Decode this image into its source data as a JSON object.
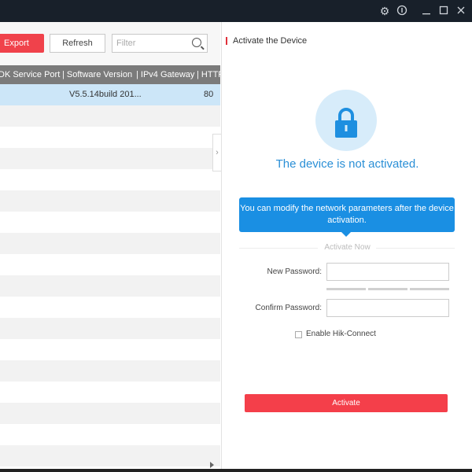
{
  "titlebar": {
    "icons": [
      "gear-icon",
      "info-icon",
      "minimize-icon",
      "maximize-icon",
      "close-icon"
    ]
  },
  "toolbar": {
    "export_label": "Export",
    "refresh_label": "Refresh",
    "filter_placeholder": "Filter"
  },
  "table": {
    "columns": [
      "DK Service Port",
      "| Software Version",
      "| IPv4 Gateway",
      "| HTTP"
    ],
    "rows": [
      {
        "software_version": "V5.5.14build 201...",
        "http": "80",
        "selected": true
      }
    ]
  },
  "panel": {
    "title": "Activate the Device",
    "status": "The device is not activated.",
    "tip": "You can modify the network parameters after the device activation.",
    "section": "Activate Now",
    "new_password_label": "New Password:",
    "confirm_password_label": "Confirm Password:",
    "new_password_value": "",
    "confirm_password_value": "",
    "hik_connect_label": "Enable Hik-Connect",
    "hik_connect_checked": false,
    "activate_label": "Activate"
  },
  "colors": {
    "accent_red": "#f43f4a",
    "accent_blue": "#1a8fe3",
    "titlebar": "#18202a"
  }
}
